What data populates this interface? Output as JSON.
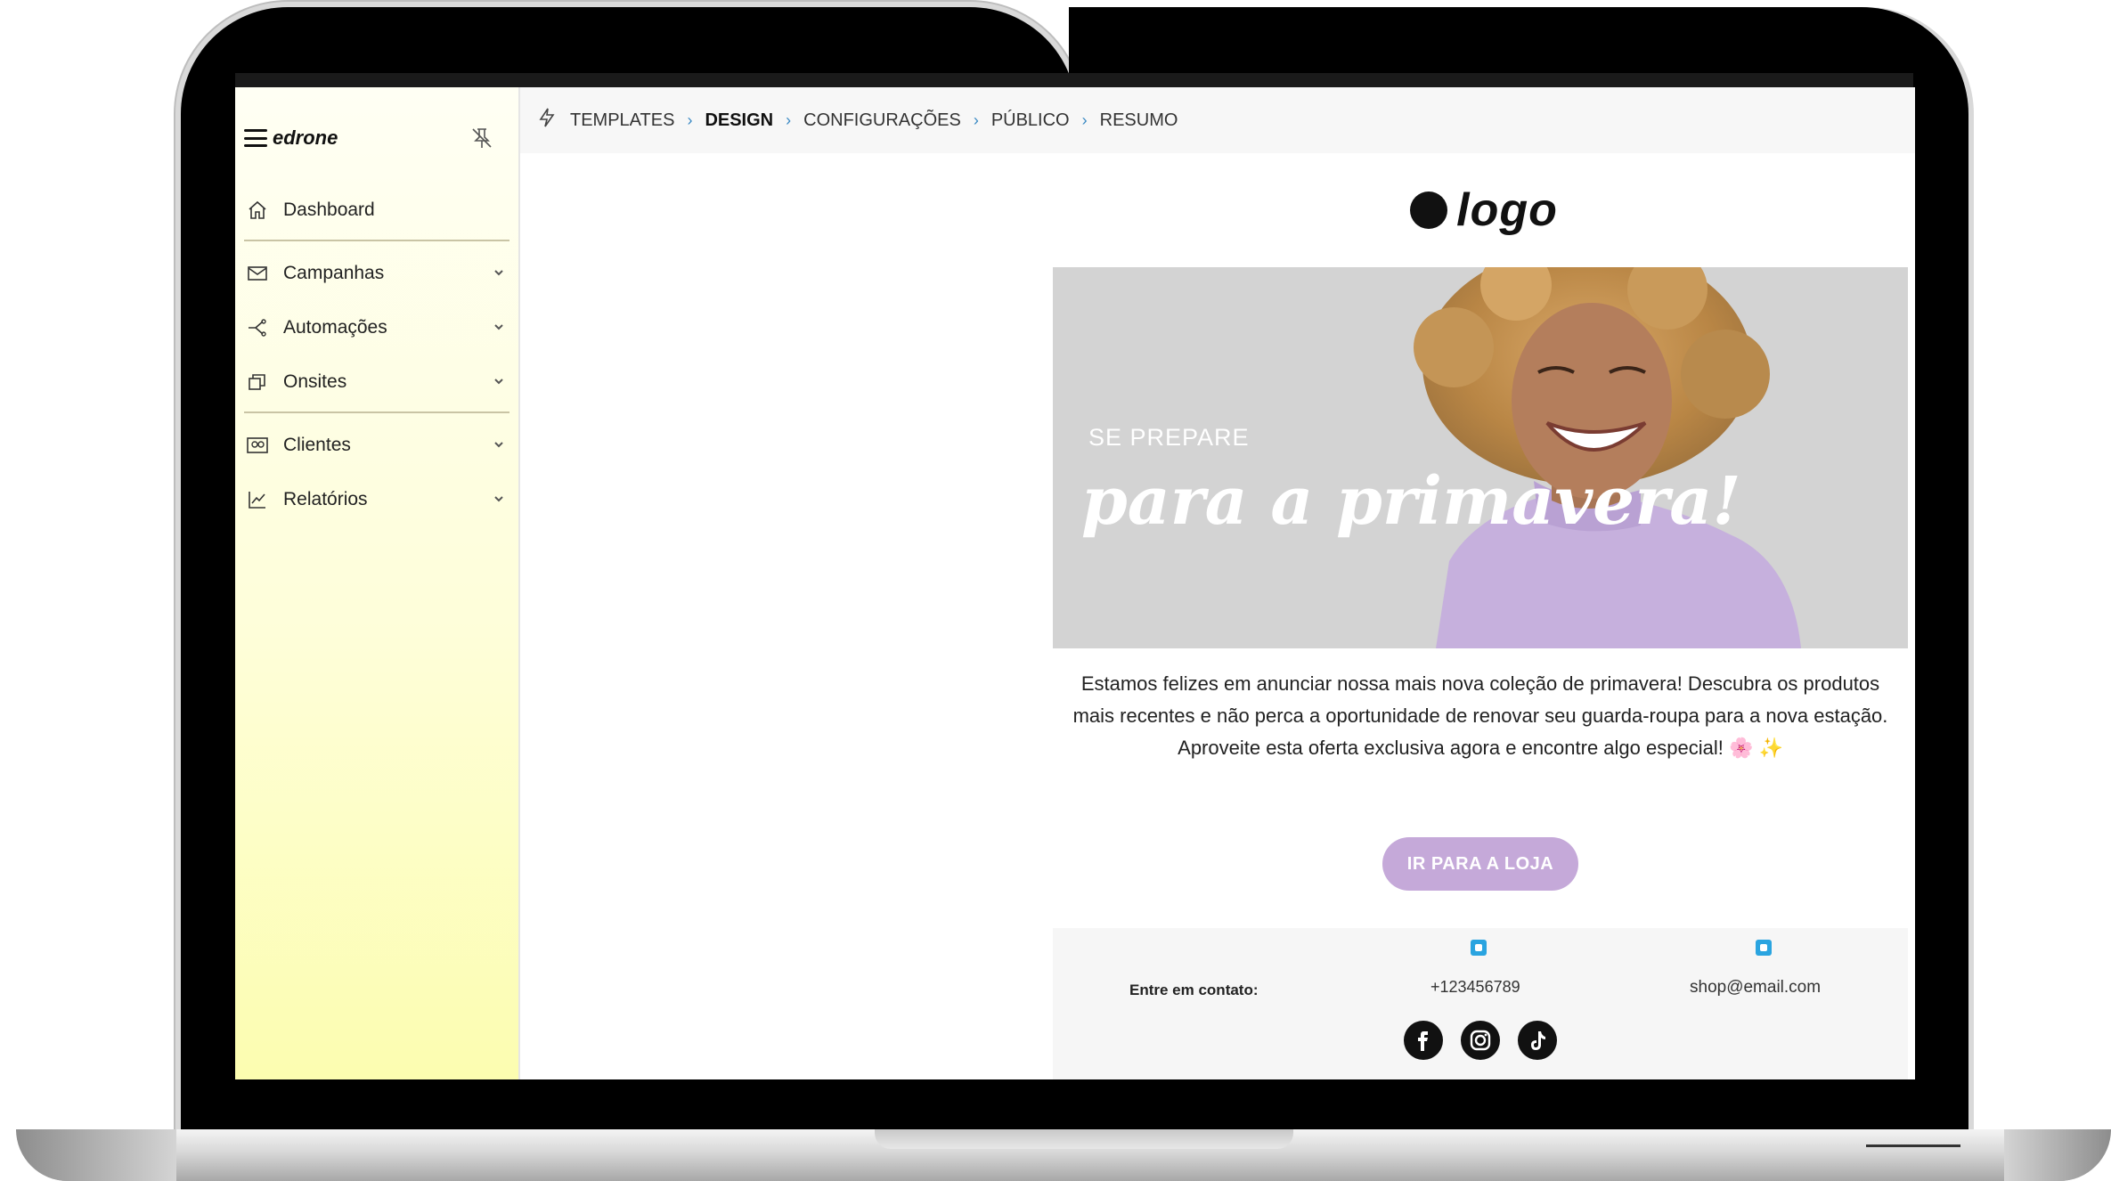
{
  "sidebar": {
    "brand": "edrone",
    "items": [
      {
        "label": "Dashboard",
        "icon": "home-icon"
      },
      {
        "label": "Campanhas",
        "icon": "mail-icon"
      },
      {
        "label": "Automações",
        "icon": "flow-icon"
      },
      {
        "label": "Onsites",
        "icon": "layers-icon"
      },
      {
        "label": "Clientes",
        "icon": "contacts-icon"
      },
      {
        "label": "Relatórios",
        "icon": "chart-icon"
      }
    ]
  },
  "breadcrumb": {
    "items": [
      "TEMPLATES",
      "DESIGN",
      "CONFIGURAÇÕES",
      "PÚBLICO",
      "RESUMO"
    ],
    "active": "DESIGN"
  },
  "email": {
    "logo_text": "logo",
    "hero_kicker": "SE PREPARE",
    "hero_title": "para a primavera!",
    "body": "Estamos felizes em anunciar nossa mais nova coleção de primavera! Descubra os produtos mais recentes e não perca a oportunidade de renovar seu guarda-roupa para a nova estação. Aproveite esta oferta exclusiva agora e encontre algo especial! 🌸 ✨",
    "cta_label": "IR PARA A LOJA",
    "footer": {
      "contact_label": "Entre em contato:",
      "phone": "+123456789",
      "email": "shop@email.com"
    }
  },
  "colors": {
    "cta": "#c5a9d9",
    "breadcrumb_separator": "#3b8ac4",
    "sidebar_gradient_end": "#fcfdb0"
  }
}
